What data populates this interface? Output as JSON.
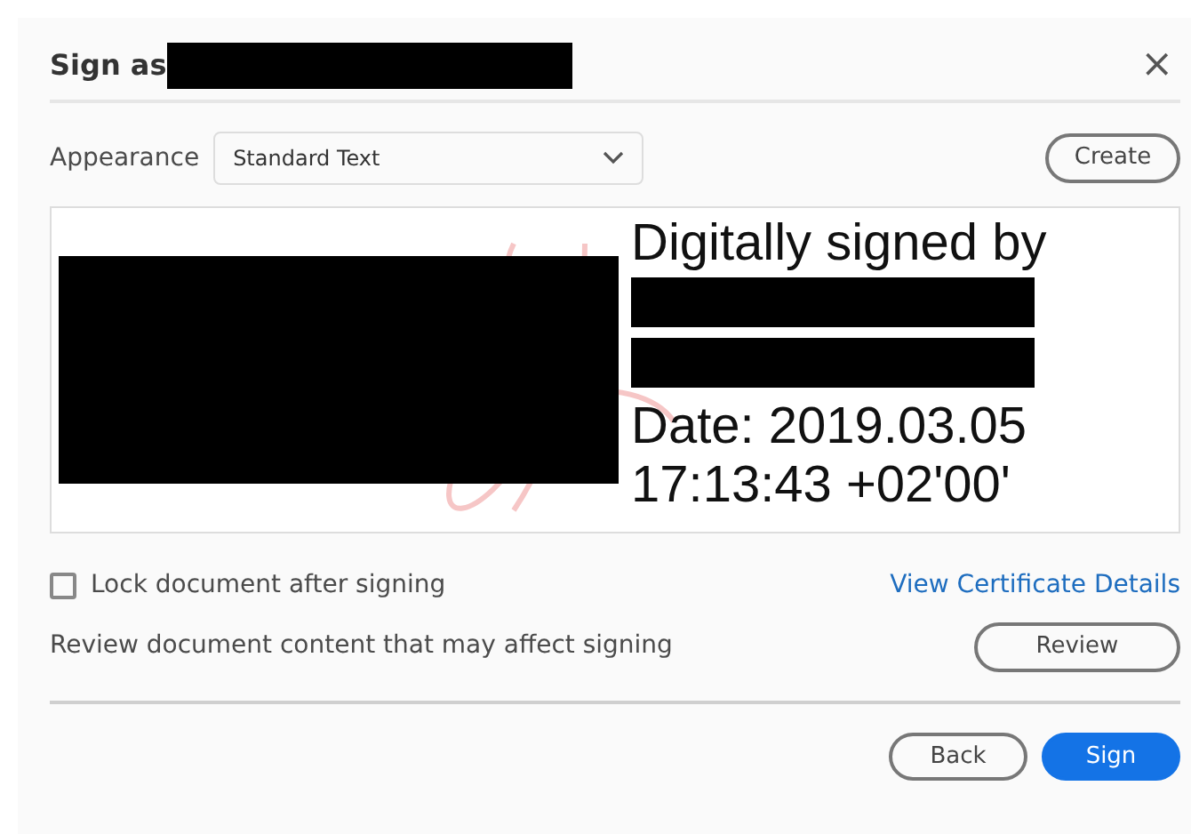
{
  "dialog": {
    "title": "Sign as",
    "title_redacted": true,
    "close": "×"
  },
  "appearance": {
    "label": "Appearance",
    "value": "Standard Text",
    "create_button": "Create"
  },
  "preview": {
    "image_redacted": true,
    "heading": "Digitally signed by",
    "redacted_lines": [
      {
        "redacted": true
      },
      {
        "redacted": true
      }
    ],
    "date_lines": [
      "Date: 2019.03.05",
      "17:13:43 +02'00'"
    ]
  },
  "lock": {
    "label": "Lock document after signing",
    "checked": false
  },
  "certificate_link": "View Certificate Details",
  "review": {
    "text": "Review document content that may affect signing",
    "button": "Review"
  },
  "buttons": [
    {
      "label": "Back",
      "kind": "secondary"
    },
    {
      "label": "Sign",
      "kind": "primary"
    }
  ]
}
